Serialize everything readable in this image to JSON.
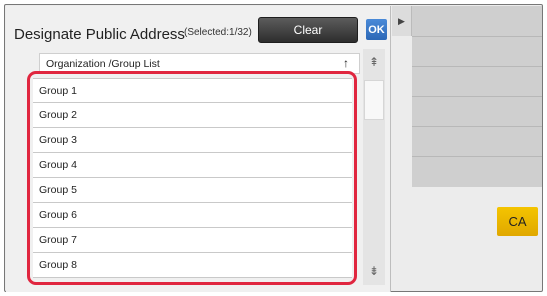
{
  "dialog": {
    "title": "Designate Public Address",
    "selected_text": "(Selected:1/32)",
    "clear_label": "Clear",
    "ok_label": "OK"
  },
  "list": {
    "header_label": "Organization /Group List",
    "sort_icon": "sort-arrow-icon",
    "sort_glyph": "↑",
    "items": [
      "Group 1",
      "Group 2",
      "Group 3",
      "Group 4",
      "Group 5",
      "Group 6",
      "Group 7",
      "Group 8"
    ]
  },
  "scrollbar": {
    "up_glyph": "⇞",
    "down_glyph": "⇟"
  },
  "side": {
    "toggle_glyph": "▶",
    "ca_label": "CA"
  },
  "colors": {
    "highlight": "#e0263f",
    "ok_button": "#3a7bd5",
    "ca_button": "#f0b800",
    "clear_button": "#3a3a3a"
  }
}
